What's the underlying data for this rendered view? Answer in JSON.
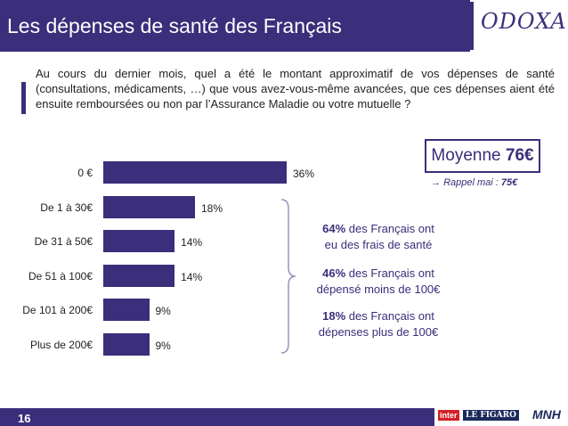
{
  "header": {
    "title": "Les dépenses de santé des Français",
    "brand": "ODOXA"
  },
  "question": "Au cours du dernier mois, quel a été le montant approximatif de vos dépenses de santé (consultations, médicaments, …) que vous avez-vous-même avancées, que ces dépenses aient été ensuite remboursées ou non par l’Assurance Maladie ou votre mutuelle ?",
  "chart_data": {
    "type": "bar",
    "orientation": "horizontal",
    "categories": [
      "0 €",
      "De 1 à 30€",
      "De 31 à 50€",
      "De 51 à 100€",
      "De 101 à 200€",
      "Plus de 200€"
    ],
    "values": [
      36,
      18,
      14,
      14,
      9,
      9
    ],
    "value_labels": [
      "36%",
      "18%",
      "14%",
      "14%",
      "9%",
      "9%"
    ],
    "xlim": [
      0,
      36
    ],
    "bar_color": "#3b2e7a"
  },
  "mean": {
    "label": "Moyenne",
    "value": "76€",
    "rappel": "Rappel mai : ",
    "rappel_value": "75€"
  },
  "stats": [
    {
      "pct": "64%",
      "text1": " des Français ont",
      "text2": "eu des frais de santé"
    },
    {
      "pct": "46%",
      "text1": " des Français ont",
      "text2": "dépensé moins de 100€"
    },
    {
      "pct": "18%",
      "text1": " des Français ont",
      "text2": "dépenses plus de 100€"
    }
  ],
  "footer": {
    "page": "16",
    "logo_inter": "inter",
    "logo_figaro": "LE FIGARO",
    "logo_mnh": "MNH"
  },
  "colors": {
    "primary": "#3b2e7a",
    "text": "#222222",
    "brace": "#8a84b0"
  }
}
